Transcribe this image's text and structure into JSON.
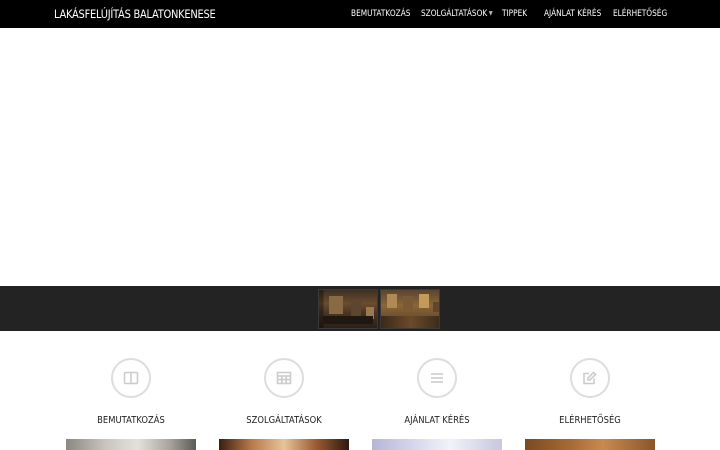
{
  "header": {
    "brand": "LAKÁSFELÚJÍTÁS BALATONKENESE",
    "nav": [
      {
        "label": "BEMUTATKOZÁS"
      },
      {
        "label": "SZOLGÁLTATÁSOK",
        "has_dropdown": true
      },
      {
        "label": "TIPPEK"
      },
      {
        "label": "AJÁNLAT KÉRÉS"
      },
      {
        "label": "ELÉRHETŐSÉG"
      }
    ]
  },
  "thumbnails": [
    {
      "icon": "interior-photo-thumbnail"
    },
    {
      "icon": "interior-photo-thumbnail"
    }
  ],
  "features": [
    {
      "title": "BEMUTATKOZÁS",
      "icon": "book-icon"
    },
    {
      "title": "SZOLGÁLTATÁSOK",
      "icon": "table-icon"
    },
    {
      "title": "AJÁNLAT KÉRÉS",
      "icon": "menu-lines-icon"
    },
    {
      "title": "ELÉRHETŐSÉG",
      "icon": "edit-icon"
    }
  ],
  "colors": {
    "navbar": "#000000",
    "strip": "#232323",
    "icon_circle": "#dddddd"
  }
}
